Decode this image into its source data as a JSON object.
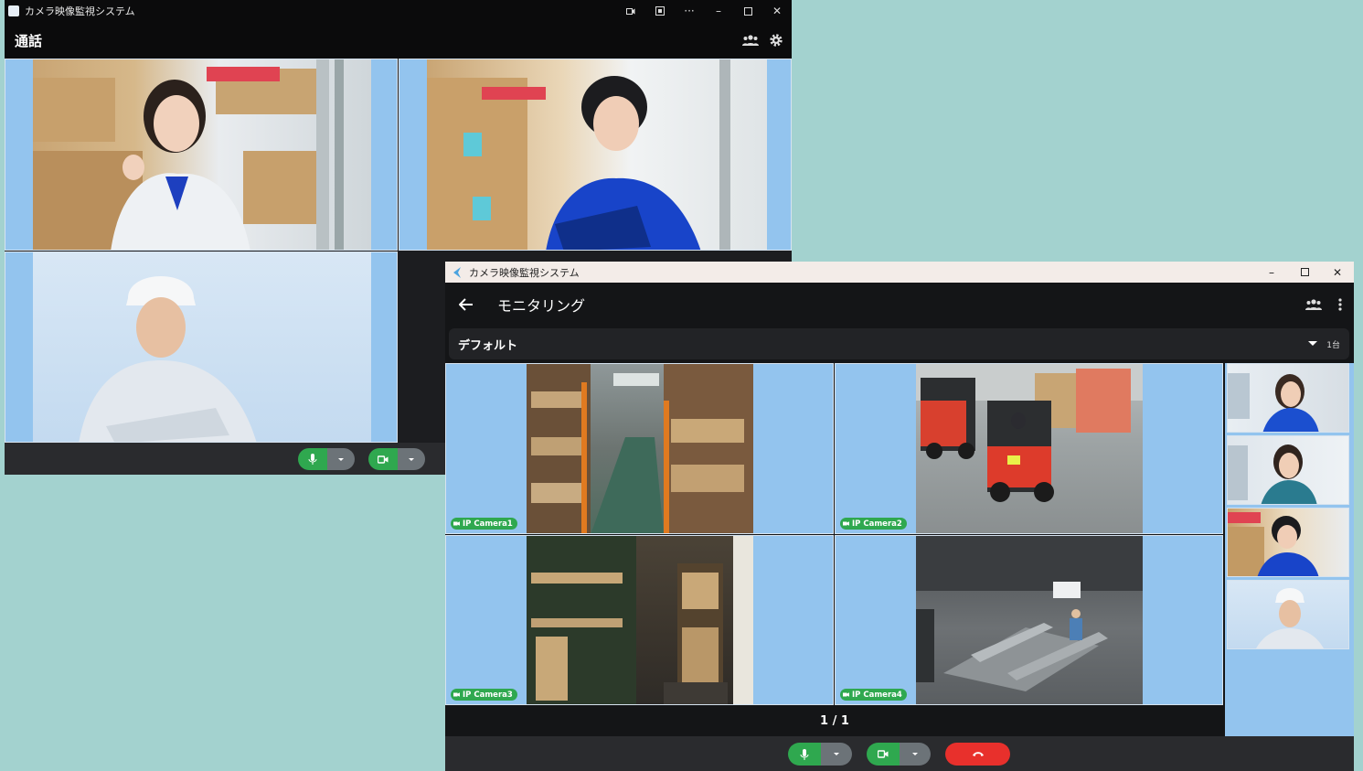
{
  "call_window": {
    "title": "カメラ映像監視システム",
    "header_title": "通話",
    "icons": [
      "participants-icon",
      "gear-icon"
    ],
    "titlebar_buttons": [
      "record-icon",
      "window-icon",
      "more-icon",
      "minimize-icon",
      "maximize-icon",
      "close-icon"
    ]
  },
  "monitor_window": {
    "title": "カメラ映像監視システム",
    "header_title": "モニタリング",
    "layout_select": {
      "value": "デフォルト",
      "count": "1台"
    },
    "cameras": [
      {
        "label": "IP Camera1"
      },
      {
        "label": "IP Camera2"
      },
      {
        "label": "IP Camera3"
      },
      {
        "label": "IP Camera4"
      }
    ],
    "pager": "1 / 1"
  },
  "colors": {
    "desktop_bg": "#a3d2cf",
    "tile_bg": "#93c4ee",
    "mic_green": "#2fa84f",
    "end_red": "#e8302c"
  }
}
